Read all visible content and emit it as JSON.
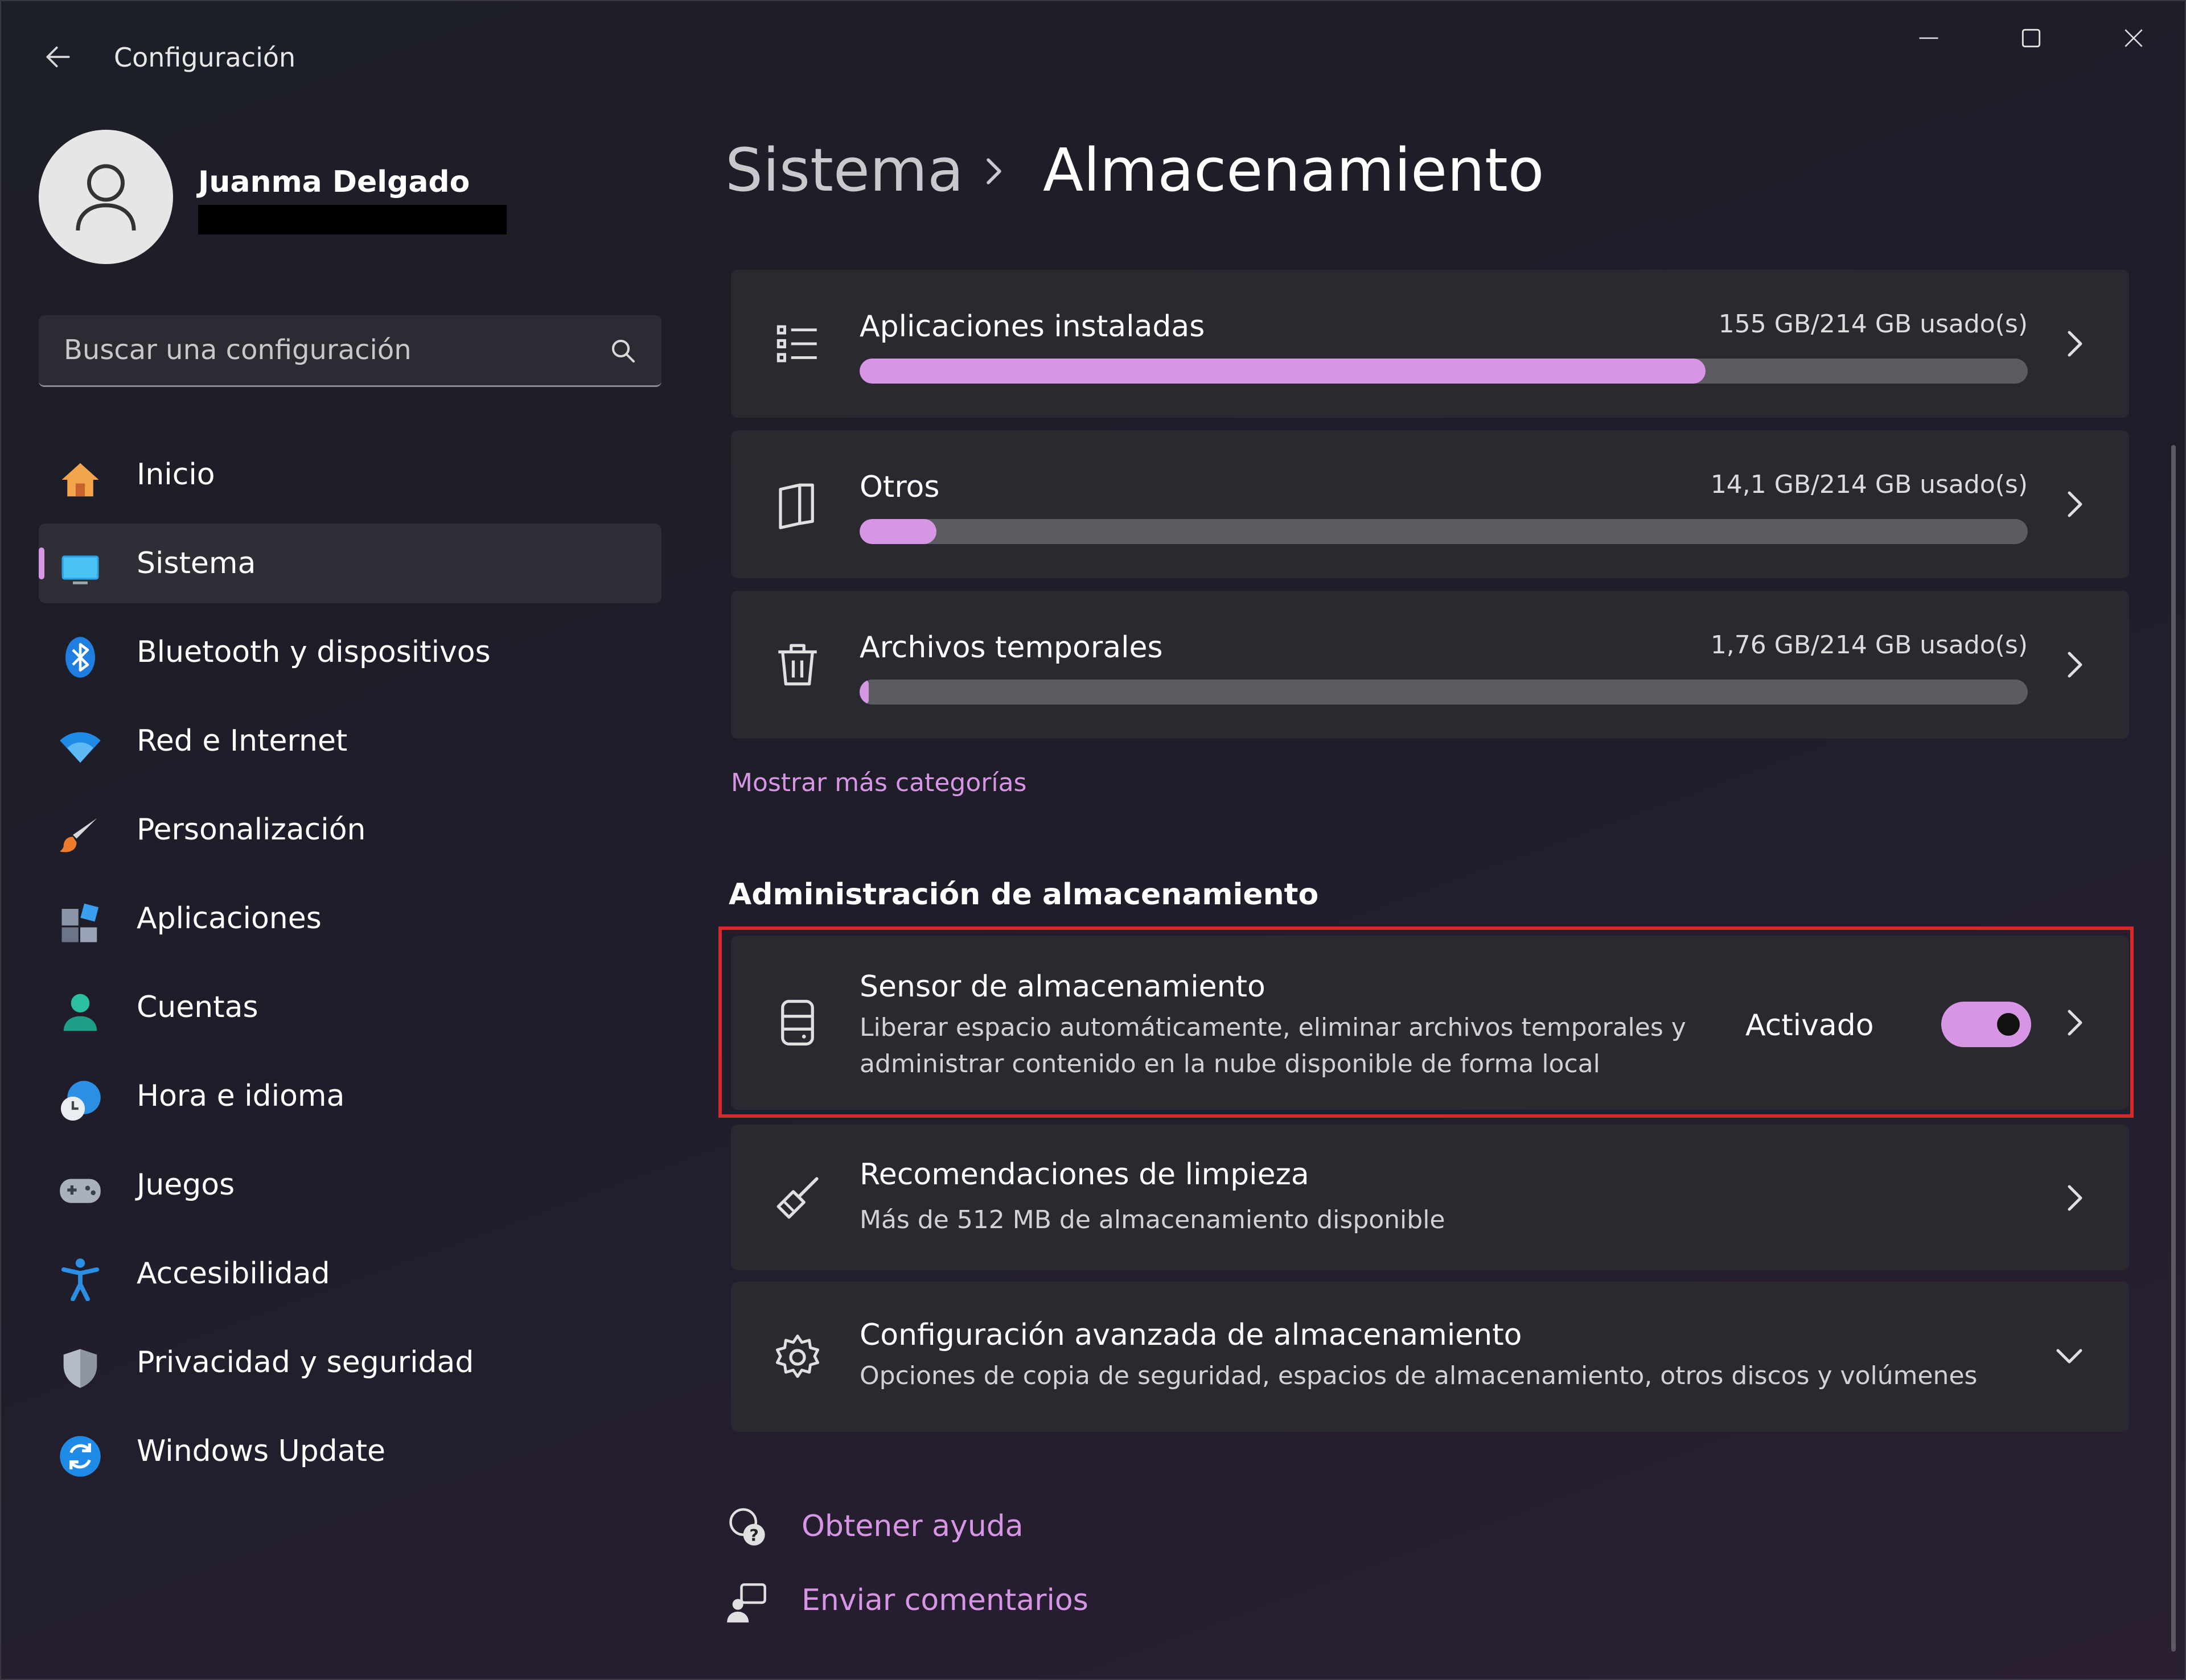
{
  "window": {
    "title": "Configuración"
  },
  "user": {
    "name": "Juanma Delgado"
  },
  "search": {
    "placeholder": "Buscar una configuración"
  },
  "nav": {
    "items": [
      {
        "label": "Inicio",
        "icon": "home-icon"
      },
      {
        "label": "Sistema",
        "icon": "monitor-icon",
        "active": true
      },
      {
        "label": "Bluetooth y dispositivos",
        "icon": "bluetooth-icon"
      },
      {
        "label": "Red e Internet",
        "icon": "wifi-icon"
      },
      {
        "label": "Personalización",
        "icon": "brush-icon"
      },
      {
        "label": "Aplicaciones",
        "icon": "apps-icon"
      },
      {
        "label": "Cuentas",
        "icon": "person-icon"
      },
      {
        "label": "Hora e idioma",
        "icon": "globe-clock-icon"
      },
      {
        "label": "Juegos",
        "icon": "gamepad-icon"
      },
      {
        "label": "Accesibilidad",
        "icon": "accessibility-icon"
      },
      {
        "label": "Privacidad y seguridad",
        "icon": "shield-icon"
      },
      {
        "label": "Windows Update",
        "icon": "update-icon"
      }
    ]
  },
  "breadcrumb": {
    "parent": "Sistema",
    "current": "Almacenamiento"
  },
  "storage": {
    "categories": [
      {
        "label": "Aplicaciones instaladas",
        "usage": "155 GB/214 GB usado(s)",
        "fraction": 0.724,
        "icon": "list-icon"
      },
      {
        "label": "Otros",
        "usage": "14,1 GB/214 GB usado(s)",
        "fraction": 0.066,
        "icon": "files-icon"
      },
      {
        "label": "Archivos temporales",
        "usage": "1,76 GB/214 GB usado(s)",
        "fraction": 0.008,
        "icon": "trash-icon"
      }
    ],
    "show_more": "Mostrar más categorías"
  },
  "management": {
    "heading": "Administración de almacenamiento",
    "sensor": {
      "title": "Sensor de almacenamiento",
      "desc_line1": "Liberar espacio automáticamente, eliminar archivos temporales y",
      "desc_line2": "administrar contenido en la nube disponible de forma local",
      "status": "Activado",
      "enabled": true
    },
    "cleanup": {
      "title": "Recomendaciones de limpieza",
      "desc": "Más de 512 MB de almacenamiento disponible"
    },
    "advanced": {
      "title": "Configuración avanzada de almacenamiento",
      "desc": "Opciones de copia de seguridad, espacios de almacenamiento, otros discos y volúmenes"
    }
  },
  "footer": {
    "help": "Obtener ayuda",
    "feedback": "Enviar comentarios"
  },
  "colors": {
    "accent": "#d796e3",
    "highlight": "#d42a2a",
    "card": "#2a2930"
  }
}
